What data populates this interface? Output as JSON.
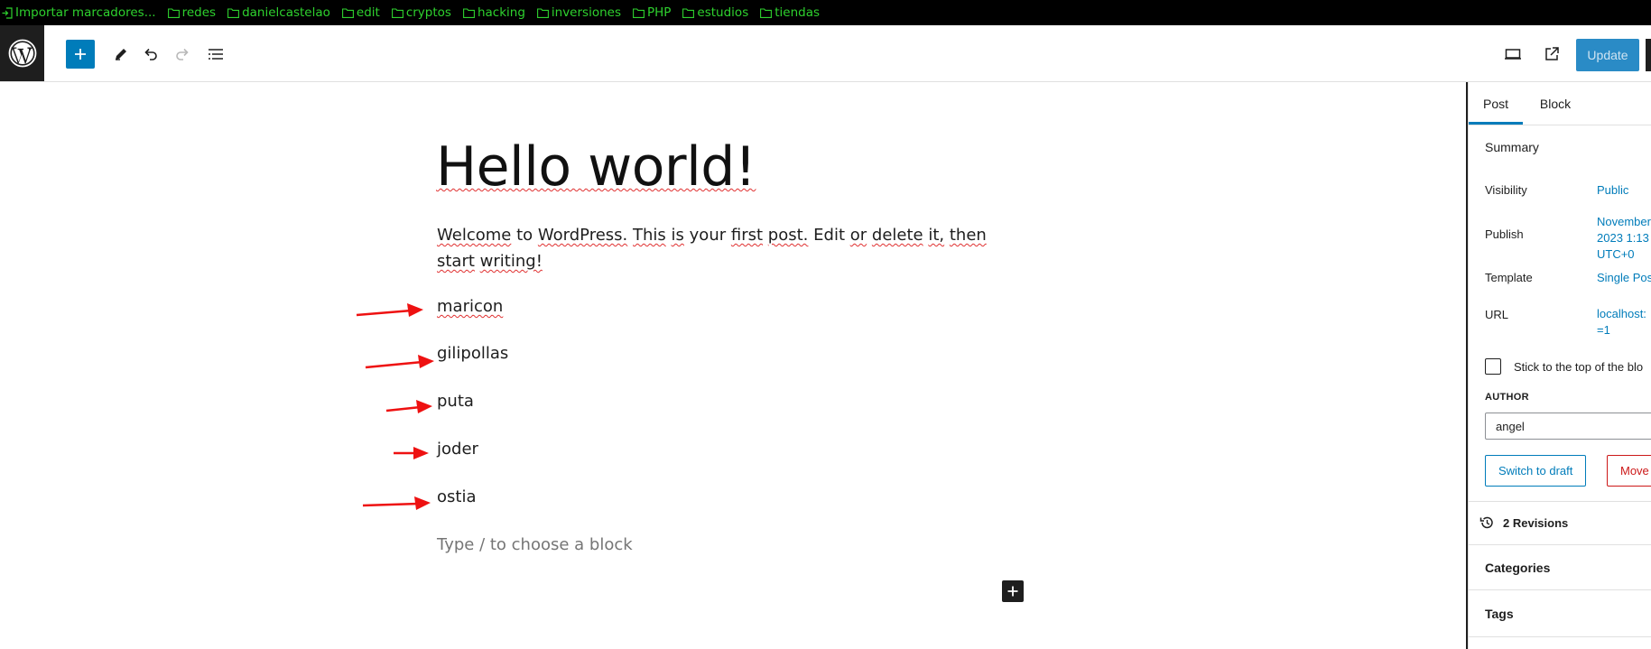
{
  "bookmarks": {
    "items": [
      {
        "label": "Importar marcadores...",
        "icon": "import-icon"
      },
      {
        "label": "redes",
        "icon": "folder-icon"
      },
      {
        "label": "danielcastelao",
        "icon": "folder-icon"
      },
      {
        "label": "edit",
        "icon": "folder-icon"
      },
      {
        "label": "cryptos",
        "icon": "folder-icon"
      },
      {
        "label": "hacking",
        "icon": "folder-icon"
      },
      {
        "label": "inversiones",
        "icon": "folder-icon"
      },
      {
        "label": "PHP",
        "icon": "folder-icon"
      },
      {
        "label": "estudios",
        "icon": "folder-icon"
      },
      {
        "label": "tiendas",
        "icon": "folder-icon"
      }
    ],
    "text_color": "#2ed12e"
  },
  "toolbar": {
    "update_label": "Update",
    "accent_color": "#007cba"
  },
  "post": {
    "title": "Hello world!",
    "intro_words": [
      "Welcome",
      "to",
      "WordPress.",
      "This",
      "is",
      "your",
      "first",
      "post.",
      "Edit",
      "or",
      "delete",
      "it,",
      "then",
      "start",
      "writing!"
    ],
    "blocks": [
      "maricon",
      "gilipollas",
      "puta",
      "joder",
      "ostia"
    ],
    "placeholder": "Type / to choose a block"
  },
  "sidebar": {
    "tabs": [
      {
        "label": "Post"
      },
      {
        "label": "Block"
      }
    ],
    "summary_title": "Summary",
    "rows": [
      {
        "label": "Visibility",
        "value": "Public"
      },
      {
        "label": "Publish",
        "value_lines": [
          "November",
          "2023 1:13",
          "UTC+0"
        ]
      },
      {
        "label": "Template",
        "value": "Single Pos"
      },
      {
        "label": "URL",
        "value_lines": [
          "localhost:",
          "=1"
        ]
      }
    ],
    "sticky_label": "Stick to the top of the blo",
    "author_label": "AUTHOR",
    "author_value": "angel",
    "switch_draft_label": "Switch to draft",
    "trash_label": "Move",
    "revisions_label": "2 Revisions",
    "categories_label": "Categories",
    "tags_label": "Tags"
  }
}
